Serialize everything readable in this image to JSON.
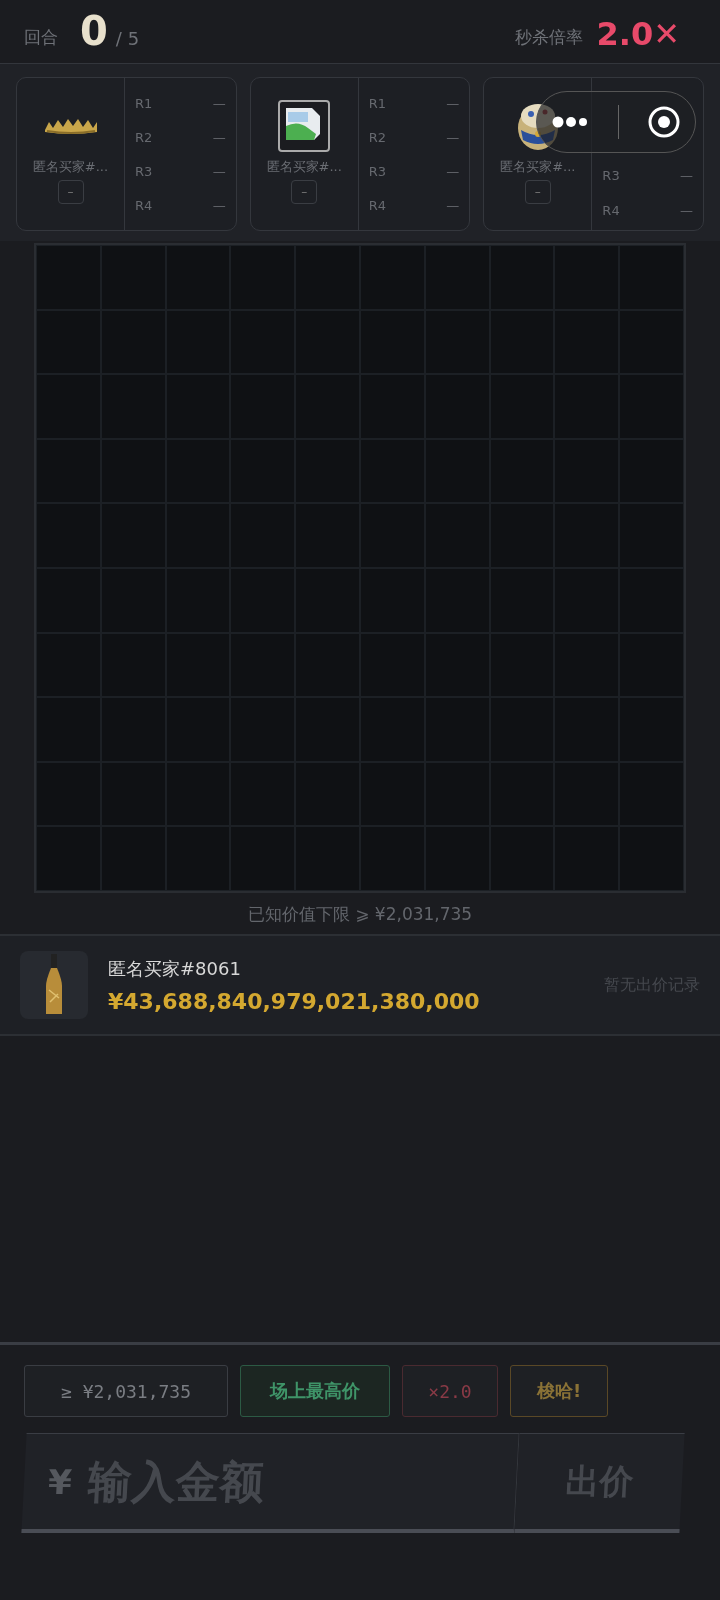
{
  "header": {
    "round_label": "回合",
    "round_value": "0",
    "round_total": "/ 5",
    "rate_label": "秒杀倍率",
    "rate_value": "2.0✕"
  },
  "buyers": [
    {
      "kind": "crown",
      "name": "匿名买家#...",
      "badge": "–",
      "rounds": [
        {
          "label": "R1",
          "value": "—"
        },
        {
          "label": "R2",
          "value": "—"
        },
        {
          "label": "R3",
          "value": "—"
        },
        {
          "label": "R4",
          "value": "—"
        }
      ]
    },
    {
      "kind": "broken",
      "name": "匿名买家#...",
      "badge": "–",
      "rounds": [
        {
          "label": "R1",
          "value": "—"
        },
        {
          "label": "R2",
          "value": "—"
        },
        {
          "label": "R3",
          "value": "—"
        },
        {
          "label": "R4",
          "value": "—"
        }
      ]
    },
    {
      "kind": "egg",
      "name": "匿名买家#...",
      "badge": "–",
      "rounds": [
        {
          "label": "R3",
          "value": "—"
        },
        {
          "label": "R4",
          "value": "—"
        }
      ]
    }
  ],
  "known_floor": "已知价值下限 ⩾ ¥2,031,735",
  "bid": {
    "buyer": "匿名买家#8061",
    "amount": "¥43,688,840,979,021,380,000",
    "status": "暂无出价记录"
  },
  "quick_buttons": [
    {
      "kind": "plain",
      "label": "≥ ¥2,031,735"
    },
    {
      "kind": "green",
      "label": "场上最高价"
    },
    {
      "kind": "red",
      "label": "×2.0"
    },
    {
      "kind": "gold",
      "label": "梭哈!"
    }
  ],
  "input": {
    "currency": "¥",
    "placeholder": "输入金额",
    "submit": "出价"
  }
}
